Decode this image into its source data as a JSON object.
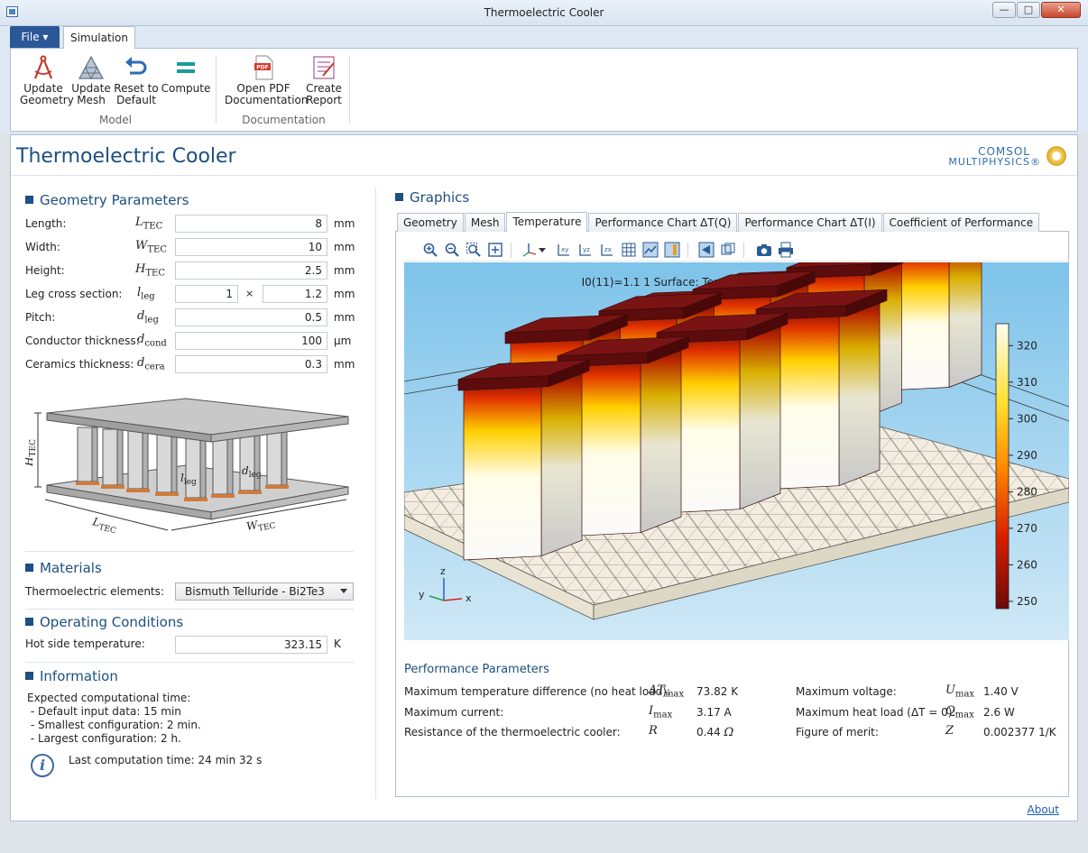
{
  "window": {
    "title": "Thermoelectric Cooler",
    "controls": {
      "minimize": "—",
      "maximize": "□",
      "close": "✕"
    }
  },
  "ribbon": {
    "file_tab": "File ▾",
    "active_tab": "Simulation",
    "buttons": [
      {
        "id": "update-geometry",
        "line1": "Update",
        "line2": "Geometry",
        "icon": "compass-icon"
      },
      {
        "id": "update-mesh",
        "line1": "Update",
        "line2": "Mesh",
        "icon": "mesh-triangle-icon"
      },
      {
        "id": "reset-default",
        "line1": "Reset to",
        "line2": "Default",
        "icon": "undo-arrow-icon"
      },
      {
        "id": "compute",
        "line1": "Compute",
        "line2": "",
        "icon": "equals-icon"
      },
      {
        "id": "open-pdf",
        "line1": "Open PDF",
        "line2": "Documentation",
        "icon": "pdf-icon"
      },
      {
        "id": "create-report",
        "line1": "Create",
        "line2": "Report",
        "icon": "report-icon"
      }
    ],
    "groups": {
      "model": "Model",
      "documentation": "Documentation"
    }
  },
  "app": {
    "title": "Thermoelectric Cooler",
    "logo_line1": "COMSOL",
    "logo_line2": "MULTIPHYSICS®"
  },
  "geometry": {
    "heading": "Geometry Parameters",
    "rows": [
      {
        "label": "Length:",
        "sym": "L",
        "sub": "TEC",
        "value": "8",
        "unit": "mm"
      },
      {
        "label": "Width:",
        "sym": "W",
        "sub": "TEC",
        "value": "10",
        "unit": "mm"
      },
      {
        "label": "Height:",
        "sym": "H",
        "sub": "TEC",
        "value": "2.5",
        "unit": "mm"
      },
      {
        "label": "Leg cross section:",
        "sym": "l",
        "sub": "leg",
        "value": "1",
        "value2": "1.2",
        "times": "×",
        "unit": "mm"
      },
      {
        "label": "Pitch:",
        "sym": "d",
        "sub": "leg",
        "value": "0.5",
        "unit": "mm"
      },
      {
        "label": "Conductor thickness:",
        "sym": "d",
        "sub": "cond",
        "value": "100",
        "unit": "µm"
      },
      {
        "label": "Ceramics thickness:",
        "sym": "d",
        "sub": "cera",
        "value": "0.3",
        "unit": "mm"
      }
    ],
    "diagram_labels": {
      "h": "H",
      "h_sub": "TEC",
      "l": "L",
      "l_sub": "TEC",
      "w": "W",
      "w_sub": "TEC",
      "leg": "l",
      "leg_sub": "leg",
      "pitch": "d",
      "pitch_sub": "leg"
    }
  },
  "materials": {
    "heading": "Materials",
    "label": "Thermoelectric elements:",
    "selected": "Bismuth Telluride - Bi2Te3"
  },
  "operating": {
    "heading": "Operating Conditions",
    "label": "Hot side temperature:",
    "value": "323.15",
    "unit": "K"
  },
  "information": {
    "heading": "Information",
    "lines": [
      "Expected computational time:",
      " - Default input data: 15 min",
      " - Smallest configuration: 2 min.",
      " - Largest configuration: 2 h."
    ],
    "last_time": "Last computation time: 24 min 32 s"
  },
  "graphics": {
    "heading": "Graphics",
    "tabs": [
      "Geometry",
      "Mesh",
      "Temperature",
      "Performance Chart ΔT(Q)",
      "Performance Chart ΔT(I)",
      "Coefficient of Performance"
    ],
    "active_tab": 2,
    "plot_title": "I0(11)=1.1 1   Surface: Temperature (K)",
    "colorbar_ticks": [
      320,
      310,
      300,
      290,
      280,
      270,
      260,
      250
    ],
    "colorbar_range": [
      248,
      326
    ],
    "axes": {
      "x": "x",
      "y": "y",
      "z": "z"
    },
    "colors": {
      "hot": "#fffde8",
      "mid": "#ffd000",
      "warm": "#e03000",
      "cold": "#6b0a0a",
      "bg_top": "#7ec3ea",
      "bg_bottom": "#cfe8f6"
    }
  },
  "performance": {
    "heading": "Performance Parameters",
    "left": [
      {
        "label": "Maximum temperature difference (no heat load):",
        "sym": "ΔT",
        "sub": "max",
        "value": "73.82",
        "unit": "K"
      },
      {
        "label": "Maximum current:",
        "sym": "I",
        "sub": "max",
        "value": "3.17",
        "unit": "A"
      },
      {
        "label": "Resistance of the thermoelectric cooler:",
        "sym": "R",
        "sub": "",
        "value": "0.44",
        "unit": "Ω"
      }
    ],
    "right": [
      {
        "label": "Maximum voltage:",
        "sym": "U",
        "sub": "max",
        "value": "1.40",
        "unit": "V"
      },
      {
        "label": "Maximum heat load (ΔT = 0):",
        "sym": "Q",
        "sub": "max",
        "value": "2.6",
        "unit": "W"
      },
      {
        "label": "Figure of merit:",
        "sym": "Z",
        "sub": "",
        "value": "0.002377",
        "unit": "1/K"
      }
    ]
  },
  "footer": {
    "about": "About"
  }
}
